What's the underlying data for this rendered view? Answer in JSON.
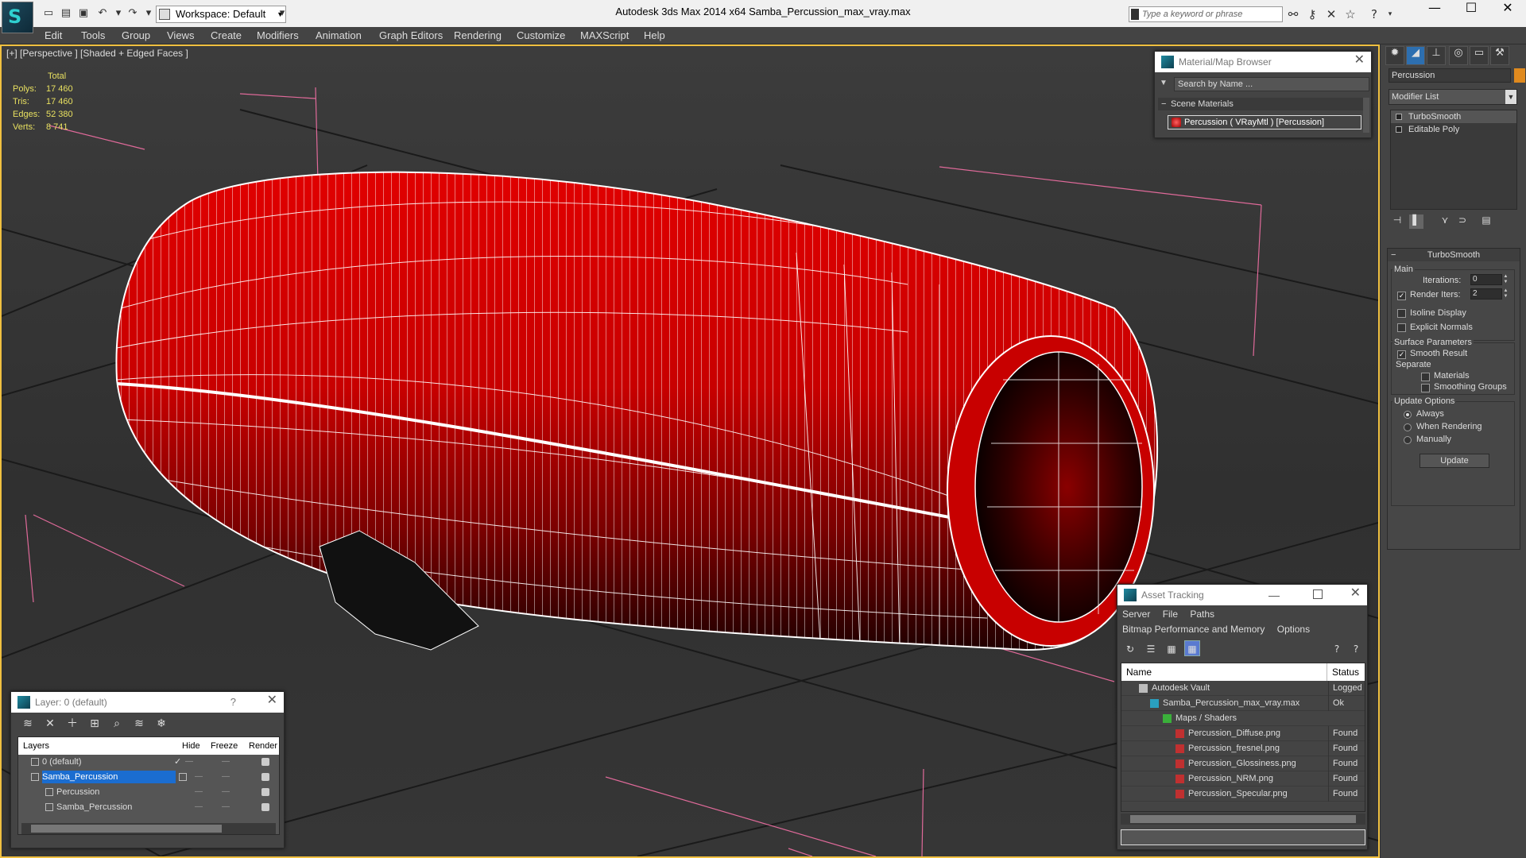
{
  "titlebar": {
    "title": "Autodesk 3ds Max  2014 x64     Samba_Percussion_max_vray.max",
    "workspace": "Workspace: Default",
    "search_placeholder": "Type a keyword or phrase",
    "min": "—",
    "max": "☐",
    "close": "✕"
  },
  "menu": [
    "Edit",
    "Tools",
    "Group",
    "Views",
    "Create",
    "Modifiers",
    "Animation",
    "Graph Editors",
    "Rendering",
    "Customize",
    "MAXScript",
    "Help"
  ],
  "viewport": {
    "label": "[+] [Perspective ] [Shaded + Edged Faces ]",
    "stats": {
      "header": "Total",
      "rows": [
        {
          "key": "Polys:",
          "value": "17 460"
        },
        {
          "key": "Tris:",
          "value": "17 460"
        },
        {
          "key": "Edges:",
          "value": "52 380"
        },
        {
          "key": "Verts:",
          "value": "8 741"
        }
      ]
    }
  },
  "material_browser": {
    "title": "Material/Map Browser",
    "search": "Search by Name ...",
    "group": "Scene Materials",
    "item": "Percussion  ( VRayMtl )  [Percussion]"
  },
  "command_panel": {
    "object_name": "Percussion",
    "object_color": "#e08a1e",
    "modifier_list": "Modifier List",
    "stack": [
      "TurboSmooth",
      "Editable Poly"
    ],
    "rollout": {
      "title": "TurboSmooth",
      "main": "Main",
      "iterations_label": "Iterations:",
      "iterations": "0",
      "render_iters_label": "Render Iters:",
      "render_iters": "2",
      "isoline": "Isoline Display",
      "explicit": "Explicit Normals",
      "surface": "Surface Parameters",
      "smooth_result": "Smooth Result",
      "separate": "Separate",
      "materials": "Materials",
      "smoothing_groups": "Smoothing Groups",
      "update_options": "Update Options",
      "always": "Always",
      "when_rendering": "When Rendering",
      "manually": "Manually",
      "update": "Update"
    }
  },
  "layer_panel": {
    "title": "Layer: 0 (default)",
    "help": "?",
    "close": "✕",
    "headers": {
      "layers": "Layers",
      "hide": "Hide",
      "freeze": "Freeze",
      "render": "Render"
    },
    "rows": [
      {
        "name": "0 (default)",
        "indent": 0
      },
      {
        "name": "Samba_Percussion",
        "indent": 0
      },
      {
        "name": "Percussion",
        "indent": 1
      },
      {
        "name": "Samba_Percussion",
        "indent": 1
      }
    ],
    "check": "✓"
  },
  "asset_tracking": {
    "title": "Asset Tracking",
    "menu1": [
      "Server",
      "File",
      "Paths"
    ],
    "menu2": [
      "Bitmap Performance and Memory",
      "Options"
    ],
    "headers": {
      "name": "Name",
      "status": "Status"
    },
    "rows": [
      {
        "name": "Autodesk Vault",
        "status": "Logged",
        "indent": 0
      },
      {
        "name": "Samba_Percussion_max_vray.max",
        "status": "Ok",
        "indent": 1
      },
      {
        "name": "Maps / Shaders",
        "status": "",
        "indent": 2
      },
      {
        "name": "Percussion_Diffuse.png",
        "status": "Found",
        "indent": 3
      },
      {
        "name": "Percussion_fresnel.png",
        "status": "Found",
        "indent": 3
      },
      {
        "name": "Percussion_Glossiness.png",
        "status": "Found",
        "indent": 3
      },
      {
        "name": "Percussion_NRM.png",
        "status": "Found",
        "indent": 3
      },
      {
        "name": "Percussion_Specular.png",
        "status": "Found",
        "indent": 3
      }
    ]
  },
  "colors": {
    "object_red": "#c80000",
    "selection_blue": "#1b6dd0",
    "active_border": "#f0c040"
  }
}
